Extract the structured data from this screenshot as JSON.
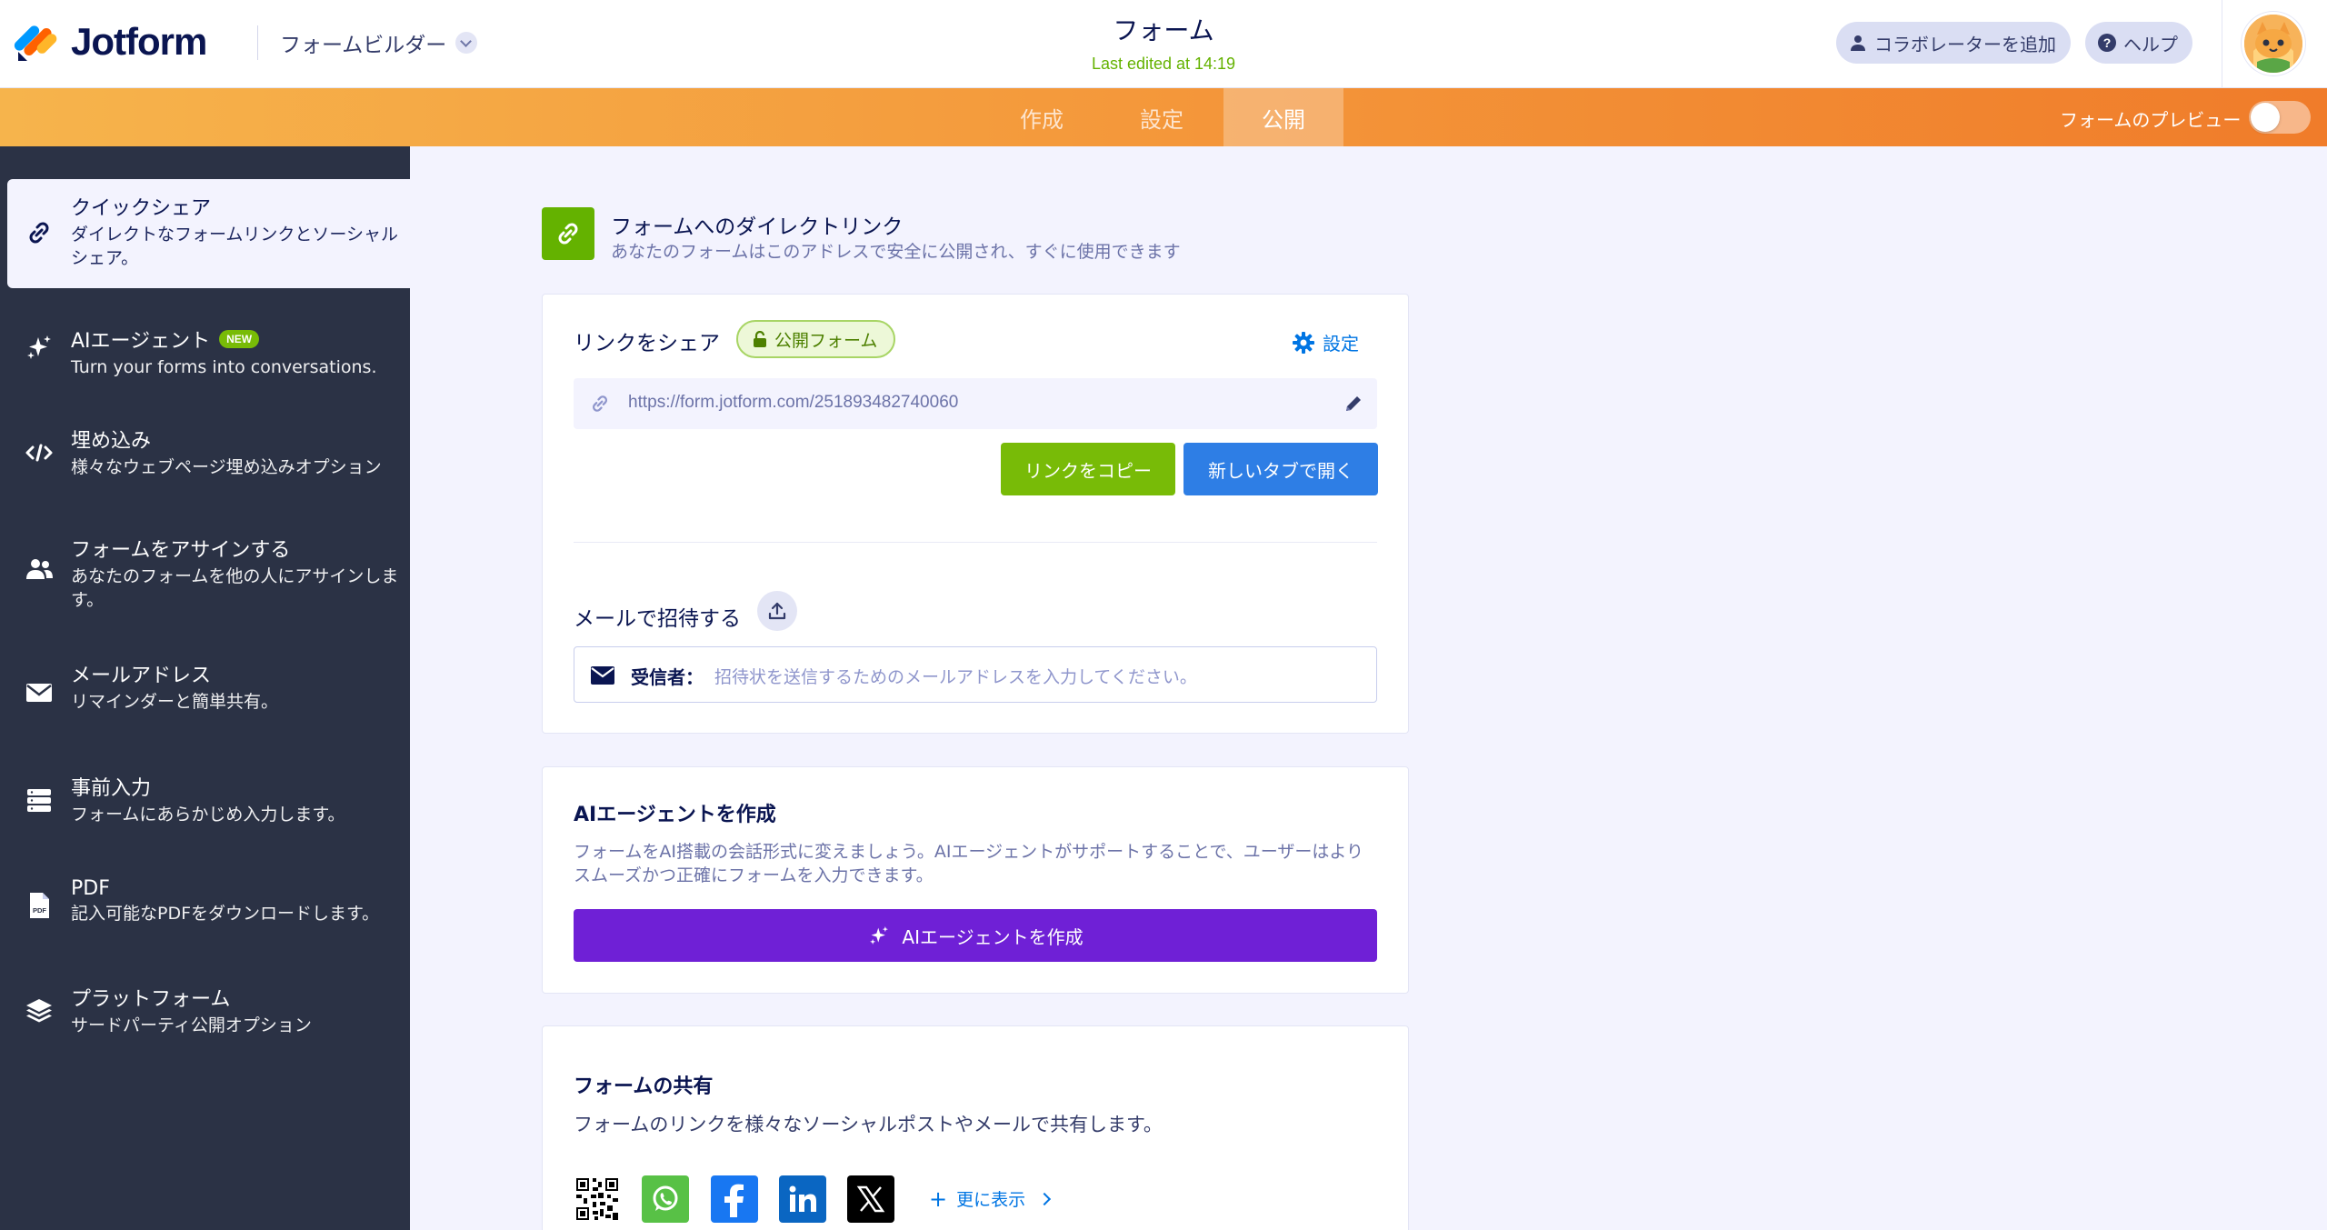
{
  "app": {
    "brand": "Jotform",
    "builder_label": "フォームビルダー",
    "form_title": "フォーム",
    "last_edited": "Last edited at 14:19"
  },
  "header": {
    "add_collaborator": "コラボレーターを追加",
    "help": "ヘルプ"
  },
  "nav": {
    "tabs": [
      {
        "label": "作成"
      },
      {
        "label": "設定"
      },
      {
        "label": "公開"
      }
    ],
    "active_tab": "公開",
    "preview_label": "フォームのプレビュー",
    "preview_on": false
  },
  "sidebar": {
    "items": [
      {
        "title": "クイックシェア",
        "desc": "ダイレクトなフォームリンクとソーシャルシェア。",
        "icon": "link-icon",
        "active": true
      },
      {
        "title": "AIエージェント",
        "badge": "NEW",
        "desc": "Turn your forms into conversations.",
        "icon": "sparkle-icon"
      },
      {
        "title": "埋め込み",
        "desc": "様々なウェブページ埋め込みオプション",
        "icon": "code-icon"
      },
      {
        "title": "フォームをアサインする",
        "desc": "あなたのフォームを他の人にアサインします。",
        "icon": "users-icon"
      },
      {
        "title": "メールアドレス",
        "desc": "リマインダーと簡単共有。",
        "icon": "envelope-icon"
      },
      {
        "title": "事前入力",
        "desc": "フォームにあらかじめ入力します。",
        "icon": "database-icon"
      },
      {
        "title": "PDF",
        "desc": "記入可能なPDFをダウンロードします。",
        "icon": "pdf-icon"
      },
      {
        "title": "プラットフォーム",
        "desc": "サードパーティ公開オプション",
        "icon": "layers-icon"
      }
    ]
  },
  "direct_link": {
    "title": "フォームへのダイレクトリンク",
    "subtitle": "あなたのフォームはこのアドレスで安全に公開され、すぐに使用できます"
  },
  "share": {
    "label": "リンクをシェア",
    "badge": "公開フォーム",
    "settings": "設定",
    "url": "https://form.jotform.com/251893482740060",
    "copy_button": "リンクをコピー",
    "open_button": "新しいタブで開く"
  },
  "invite": {
    "label": "メールで招待する",
    "to_label": "受信者：",
    "placeholder": "招待状を送信するためのメールアドレスを入力してください。"
  },
  "ai_agent": {
    "title": "AIエージェントを作成",
    "desc": "フォームをAI搭載の会話形式に変えましょう。AIエージェントがサポートすることで、ユーザーはよりスムーズかつ正確にフォームを入力できます。",
    "button": "AIエージェントを作成"
  },
  "form_share": {
    "title": "フォームの共有",
    "desc": "フォームのリンクを様々なソーシャルポストやメールで共有します。",
    "more": "更に表示"
  },
  "colors": {
    "accent_green": "#78bb07",
    "accent_blue": "#2e7ee5",
    "accent_purple": "#6f20d6",
    "sidebar_bg": "#2b3245",
    "nav_orange": "#f49a3c"
  }
}
